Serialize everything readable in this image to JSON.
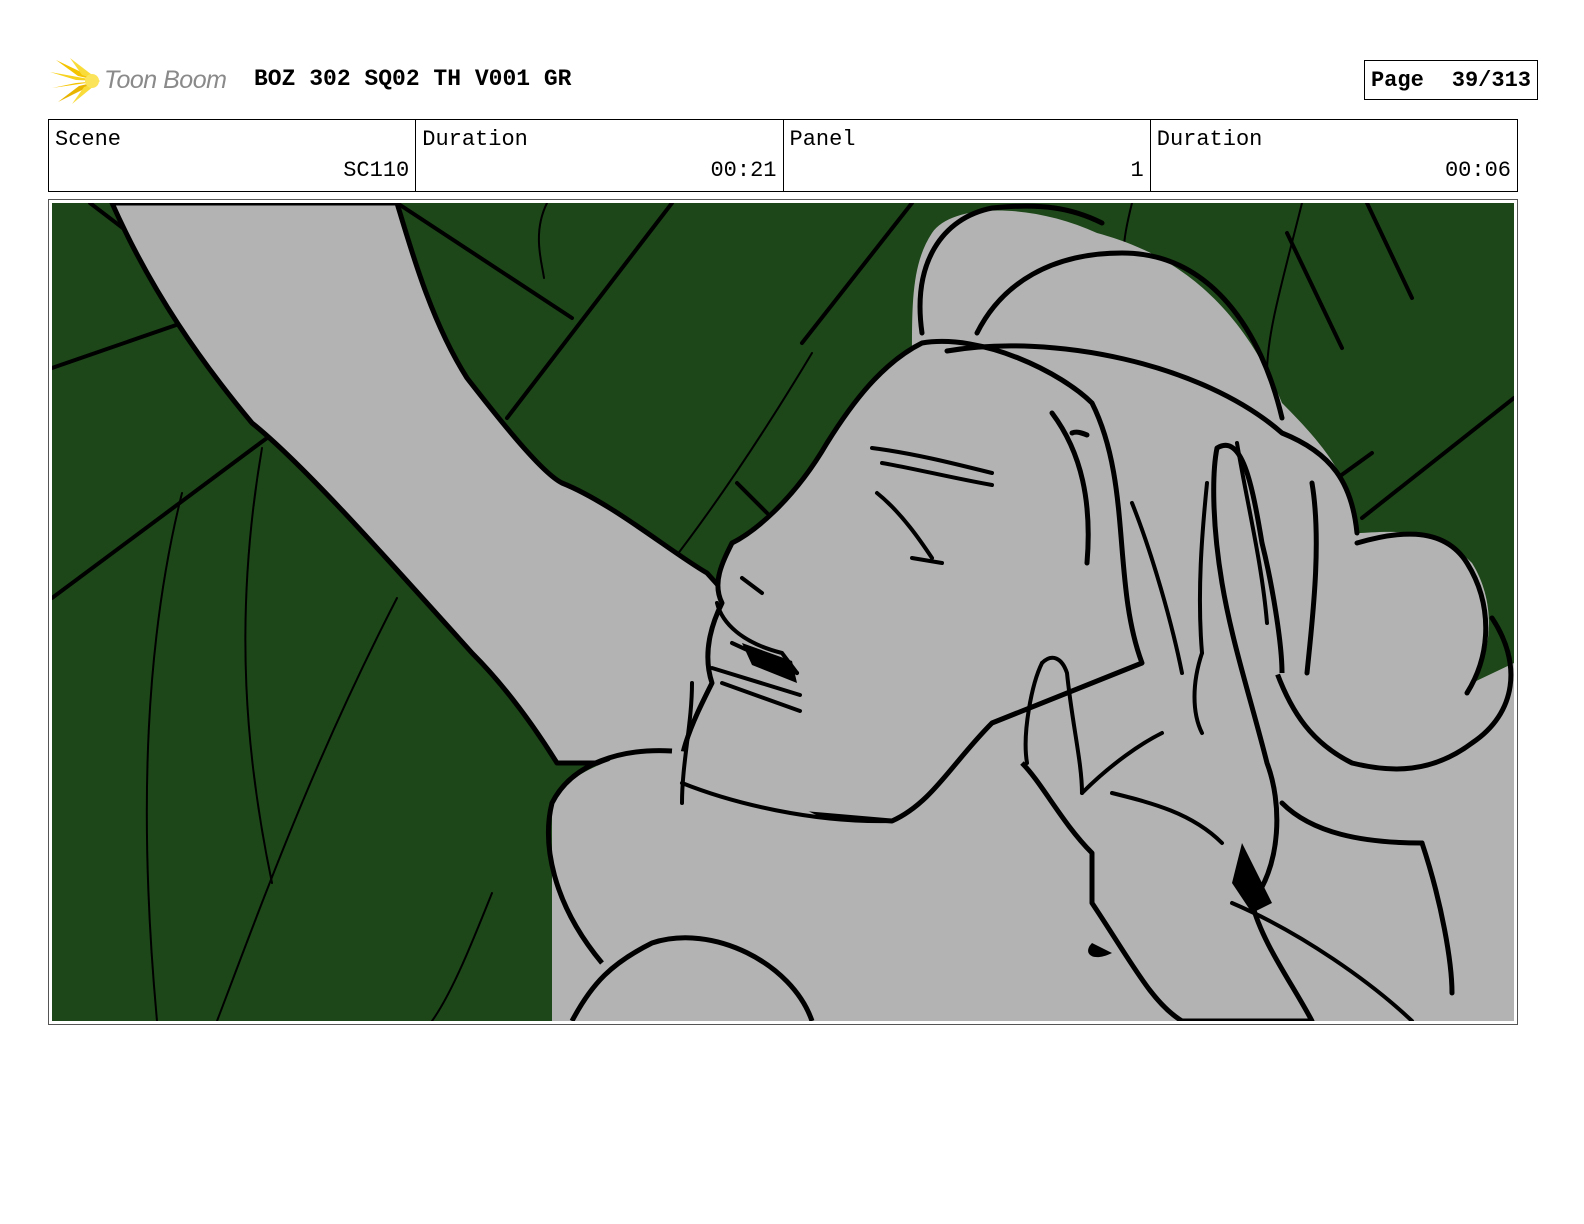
{
  "header": {
    "logo_text": "Toon Boom",
    "title": "BOZ 302 SQ02 TH V001 GR",
    "page_label": "Page",
    "page_value": "39/313"
  },
  "info": [
    {
      "label": "Scene",
      "value": "SC110"
    },
    {
      "label": "Duration",
      "value": "00:21"
    },
    {
      "label": "Panel",
      "value": "1"
    },
    {
      "label": "Duration",
      "value": "00:06"
    }
  ],
  "panel": {
    "background_color": "#1d4719",
    "figure_color": "#b3b3b3",
    "line_color": "#000000"
  },
  "colors": {
    "logo_accent": "#f5c400",
    "logo_text": "#8a8a8a"
  }
}
